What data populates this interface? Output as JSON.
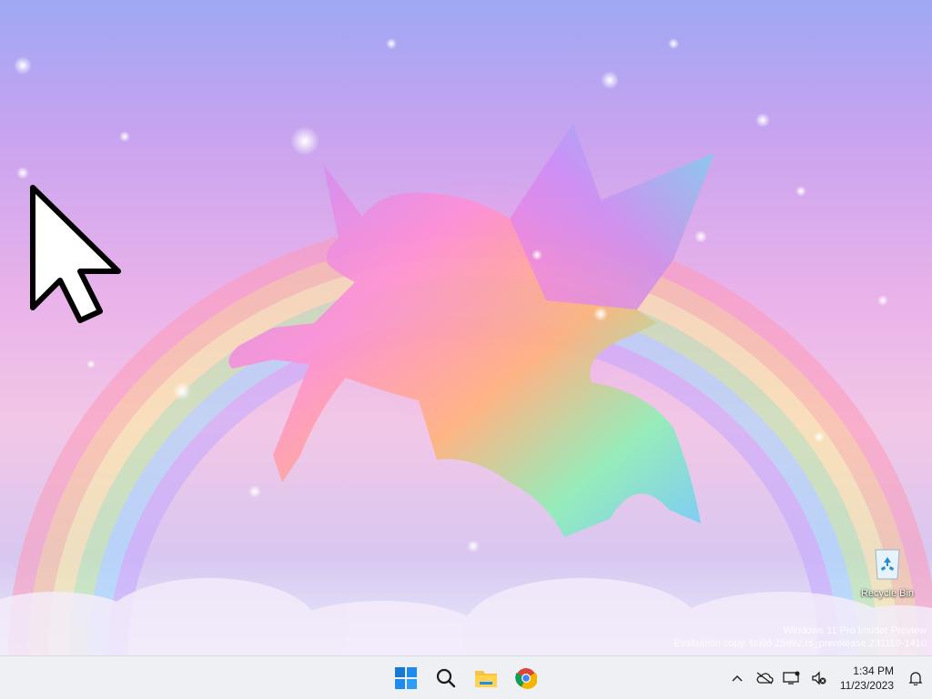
{
  "desktop": {
    "wallpaper": "rainbow-unicorn-wallpaper",
    "icons": [
      {
        "label": "Recycle Bin",
        "icon": "recycle-bin-icon"
      }
    ],
    "watermark": {
      "line1": "Windows 11 Pro Insider Preview",
      "line2": "Evaluation copy. Build 25992.rs_prerelease.231110-1410"
    }
  },
  "taskbar": {
    "apps": [
      {
        "name": "Start",
        "icon": "windows-start-icon"
      },
      {
        "name": "Search",
        "icon": "search-icon"
      },
      {
        "name": "File Explorer",
        "icon": "file-explorer-icon"
      },
      {
        "name": "Google Chrome",
        "icon": "chrome-icon"
      }
    ],
    "tray": {
      "icons": [
        "chevron-up-icon",
        "onedrive-offline-icon",
        "network-icon",
        "volume-muted-icon"
      ],
      "time": "1:34 PM",
      "date": "11/23/2023",
      "notification_icon": "bell-icon"
    }
  },
  "colors": {
    "taskbar_bg": "#eef0f4",
    "windows_blue": "#1a73e8"
  }
}
